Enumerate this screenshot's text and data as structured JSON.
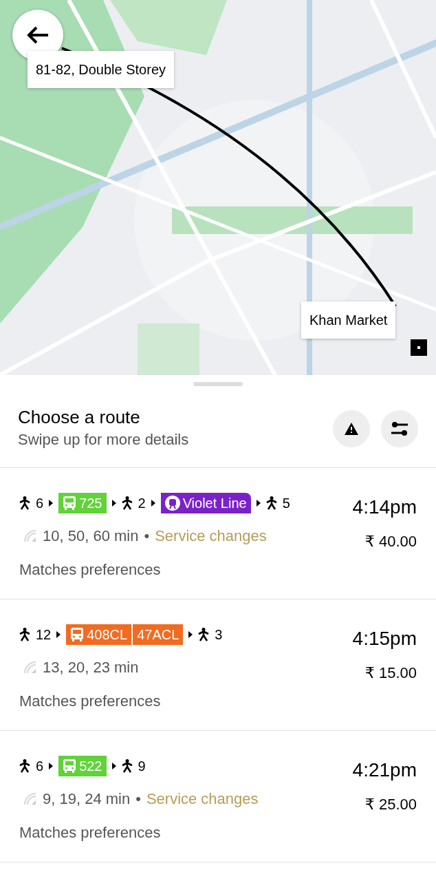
{
  "map": {
    "kind": "picture",
    "origin_label": "81-82, Double Storey",
    "destination_label": "Khan Market"
  },
  "sheet": {
    "title": "Choose a route",
    "subtitle": "Swipe up for more details"
  },
  "routes": [
    {
      "legs": [
        {
          "kind": "walk",
          "text": "6"
        },
        {
          "kind": "bus",
          "color": "#5fd338",
          "lines": [
            "725"
          ]
        },
        {
          "kind": "walk",
          "text": "2"
        },
        {
          "kind": "metro",
          "color": "#7a22c9",
          "lines": [
            "Violet Line"
          ]
        },
        {
          "kind": "walk",
          "text": "5"
        }
      ],
      "frequency": "10, 50, 60 min",
      "separator": "•",
      "notice": "Service changes",
      "arrival": "4:14pm",
      "fare": "₹ 40.00",
      "note": "Matches preferences"
    },
    {
      "legs": [
        {
          "kind": "walk",
          "text": "12"
        },
        {
          "kind": "bus",
          "color": "#f26b21",
          "lines": [
            "408CL",
            "47ACL"
          ]
        },
        {
          "kind": "walk",
          "text": "3"
        }
      ],
      "frequency": "13, 20, 23 min",
      "arrival": "4:15pm",
      "fare": "₹ 15.00",
      "note": "Matches preferences"
    },
    {
      "legs": [
        {
          "kind": "walk",
          "text": "6"
        },
        {
          "kind": "bus",
          "color": "#5fd338",
          "lines": [
            "522"
          ]
        },
        {
          "kind": "walk",
          "text": "9"
        }
      ],
      "frequency": "9, 19, 24 min",
      "separator": "•",
      "notice": "Service changes",
      "arrival": "4:21pm",
      "fare": "₹ 25.00",
      "note": "Matches preferences"
    }
  ]
}
